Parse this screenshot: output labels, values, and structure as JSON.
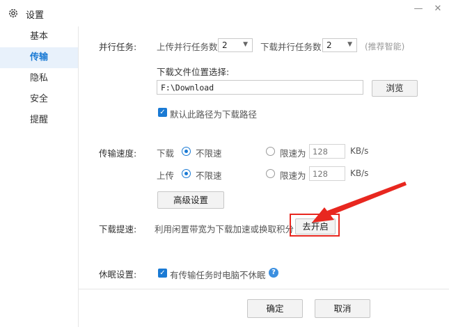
{
  "window": {
    "title": "设置"
  },
  "sidebar": {
    "items": [
      "基本",
      "传输",
      "隐私",
      "安全",
      "提醒"
    ]
  },
  "parallel": {
    "label": "并行任务:",
    "upload_label": "上传并行任务数",
    "upload_value": "2",
    "download_label": "下载并行任务数",
    "download_value": "2",
    "hint": "(推荐智能)"
  },
  "location": {
    "label": "下载文件位置选择:",
    "path": "F:\\Download",
    "browse": "浏览",
    "default_check": "默认此路径为下载路径"
  },
  "speed": {
    "label": "传输速度:",
    "download": {
      "label": "下载",
      "unlimited": "不限速",
      "limit": "限速为",
      "value": "128",
      "unit": "KB/s"
    },
    "upload": {
      "label": "上传",
      "unlimited": "不限速",
      "limit": "限速为",
      "value": "128",
      "unit": "KB/s"
    },
    "advanced": "高级设置"
  },
  "accel": {
    "label": "下载提速:",
    "text": "利用闲置带宽为下载加速或换取积分",
    "button": "去开启"
  },
  "sleep": {
    "label": "休眠设置:",
    "check": "有传输任务时电脑不休眠",
    "help": "?"
  },
  "footer": {
    "ok": "确定",
    "cancel": "取消"
  },
  "colors": {
    "accent": "#1a7ad4",
    "annotation": "#e8271f"
  }
}
